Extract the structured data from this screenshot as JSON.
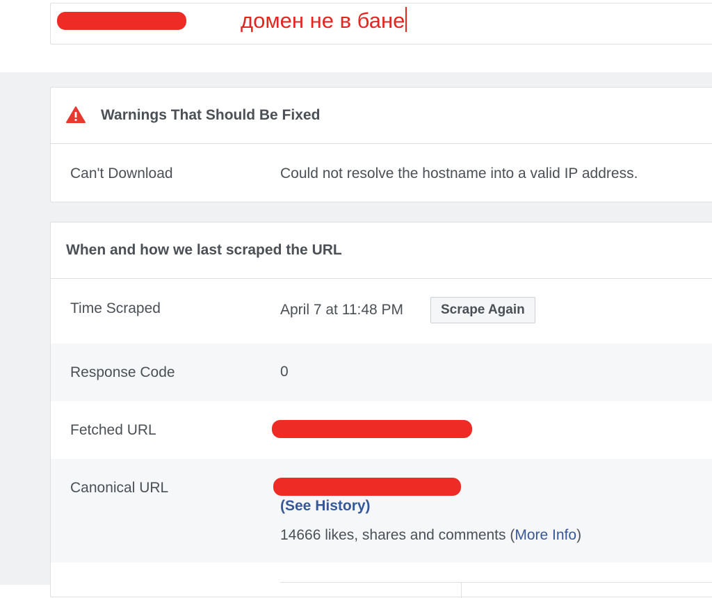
{
  "url_bar": {
    "annotation": "домен не в бане"
  },
  "warnings_card": {
    "title": "Warnings That Should Be Fixed",
    "icon": "warning-triangle-icon",
    "rows": [
      {
        "label": "Can't Download",
        "value": "Could not resolve the hostname into a valid IP address."
      }
    ]
  },
  "scrape_card": {
    "title": "When and how we last scraped the URL",
    "time_scraped": {
      "label": "Time Scraped",
      "value": "April 7 at 11:48 PM",
      "button": "Scrape Again"
    },
    "response_code": {
      "label": "Response Code",
      "value": "0"
    },
    "fetched_url": {
      "label": "Fetched URL"
    },
    "canonical_url": {
      "label": "Canonical URL",
      "see_history": "(See History)",
      "engagement_prefix": "14666 likes, shares and comments (",
      "engagement_link": "More Info",
      "engagement_suffix": ")"
    }
  },
  "colors": {
    "annotation_red": "#e3261f",
    "redaction_red": "#ef2b26",
    "link_blue": "#365899",
    "page_gray": "#f0f1f3"
  }
}
